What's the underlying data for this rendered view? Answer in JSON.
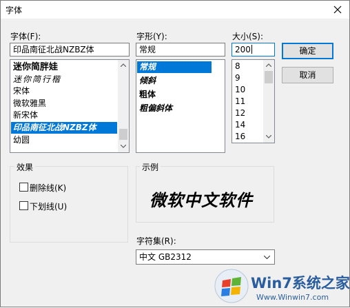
{
  "window": {
    "title": "字体",
    "close_icon": "close-icon"
  },
  "font": {
    "label": "字体(F):",
    "value": "印品南征北战NZBZ体",
    "items": [
      {
        "label": "迷你简胖娃",
        "style": "bold"
      },
      {
        "label": "迷你简行楷",
        "style": "script"
      },
      {
        "label": "宋体",
        "style": "normal"
      },
      {
        "label": "微软雅黑",
        "style": "normal"
      },
      {
        "label": "新宋体",
        "style": "normal"
      },
      {
        "label": "印品南征北战NZBZ体",
        "style": "decor",
        "selected": true
      },
      {
        "label": "幼圆",
        "style": "normal"
      }
    ]
  },
  "style": {
    "label": "字形(Y):",
    "value": "常规",
    "items": [
      {
        "label": "常规",
        "selected": true
      },
      {
        "label": "倾斜"
      },
      {
        "label": "粗体"
      },
      {
        "label": "粗偏斜体"
      }
    ]
  },
  "size": {
    "label": "大小(S):",
    "value": "200",
    "items": [
      "8",
      "9",
      "10",
      "11",
      "12",
      "14",
      "16"
    ]
  },
  "buttons": {
    "ok": "确定",
    "cancel": "取消"
  },
  "effects": {
    "label": "效果",
    "strikeout": {
      "label": "删除线(K)",
      "checked": false
    },
    "underline": {
      "label": "下划线(U)",
      "checked": false
    }
  },
  "sample": {
    "label": "示例",
    "text": "微软中文软件"
  },
  "charset": {
    "label": "字符集(R):",
    "value": "中文 GB2312"
  },
  "watermark": {
    "brand": "Win7系统之家",
    "url": "Www.Winwin7.com"
  }
}
